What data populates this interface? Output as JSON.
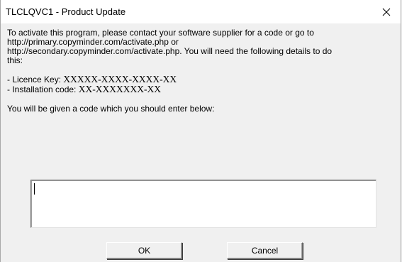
{
  "window": {
    "title": "TLCLQVC1 - Product Update",
    "close_icon": "close-icon"
  },
  "body": {
    "line1": "To activate this program, please contact your software supplier for a code or go to",
    "line2": "http://primary.copyminder.com/activate.php or",
    "line3": "http://secondary.copyminder.com/activate.php.  You will need the following details to do",
    "line4": "this:",
    "licence_label": "- Licence Key:",
    "licence_value": "XXXXX-XXXX-XXXX-XX",
    "install_label": "- Installation code:",
    "install_value": "XX-XXXXXXX-XX",
    "instruction": "You will be given a code which you should enter below:"
  },
  "code_input": {
    "value": ""
  },
  "buttons": {
    "ok": "OK",
    "cancel": "Cancel"
  }
}
